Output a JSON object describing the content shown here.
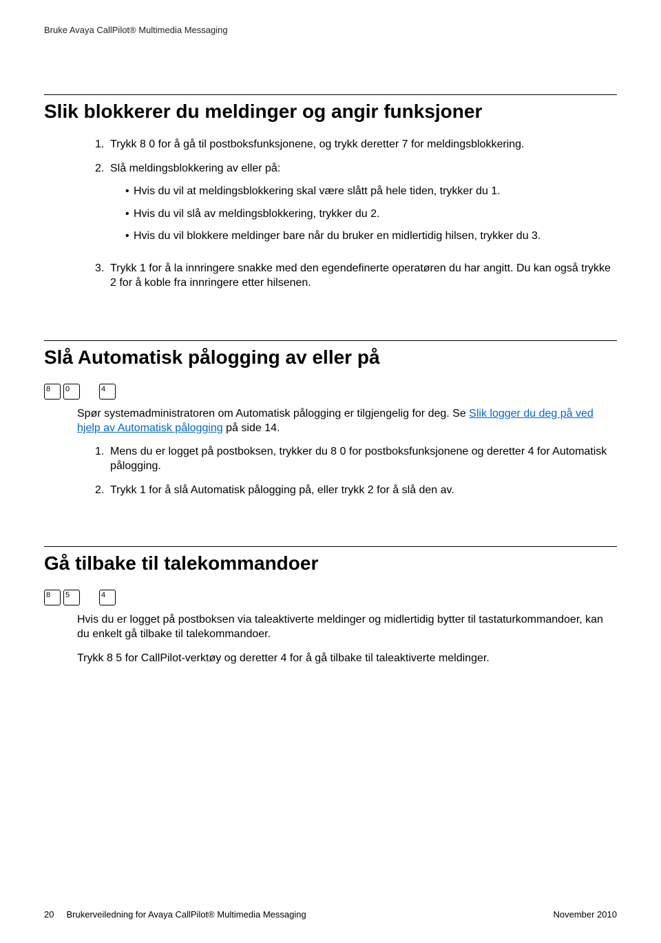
{
  "header": {
    "running": "Bruke Avaya CallPilot® Multimedia Messaging"
  },
  "section1": {
    "title": "Slik blokkerer du meldinger og angir funksjoner",
    "steps": {
      "s1": {
        "num": "1.",
        "text": "Trykk 8 0 for å gå til postboksfunksjonene, og trykk deretter 7 for meldingsblokkering."
      },
      "s2": {
        "num": "2.",
        "text": "Slå meldingsblokkering av eller på:",
        "bullets": {
          "b1": "Hvis du vil at meldingsblokkering skal være slått på hele tiden, trykker du 1.",
          "b2": "Hvis du vil slå av meldingsblokkering, trykker du 2.",
          "b3": "Hvis du vil blokkere meldinger bare når du bruker en midlertidig hilsen, trykker du 3."
        }
      },
      "s3": {
        "num": "3.",
        "text": "Trykk 1 for å la innringere snakke med den egendefinerte operatøren du har angitt. Du kan også trykke 2 for å koble fra innringere etter hilsenen."
      }
    }
  },
  "section2": {
    "title": "Slå Automatisk pålogging av eller på",
    "keys": {
      "k1": "8",
      "k2": "0",
      "k3": "4"
    },
    "intro_a": "Spør systemadministratoren om Automatisk pålogging er tilgjengelig for deg. Se ",
    "intro_link": "Slik logger du deg på ved hjelp av Automatisk pålogging",
    "intro_b": " på side 14.",
    "steps": {
      "s1": {
        "num": "1.",
        "text": "Mens du er logget på postboksen, trykker du 8 0 for postboksfunksjonene og deretter 4 for Automatisk pålogging."
      },
      "s2": {
        "num": "2.",
        "text": "Trykk 1 for å slå Automatisk pålogging på, eller trykk 2 for å slå den av."
      }
    }
  },
  "section3": {
    "title": "Gå tilbake til talekommandoer",
    "keys": {
      "k1": "8",
      "k2": "5",
      "k3": "4"
    },
    "p1": "Hvis du er logget på postboksen via taleaktiverte meldinger og midlertidig bytter til tastaturkommandoer, kan du enkelt gå tilbake til talekommandoer.",
    "p2": "Trykk 8 5 for CallPilot-verktøy og deretter 4 for å gå tilbake til taleaktiverte meldinger."
  },
  "footer": {
    "page": "20",
    "doc": "Brukerveiledning for Avaya CallPilot® Multimedia Messaging",
    "date": "November 2010"
  }
}
